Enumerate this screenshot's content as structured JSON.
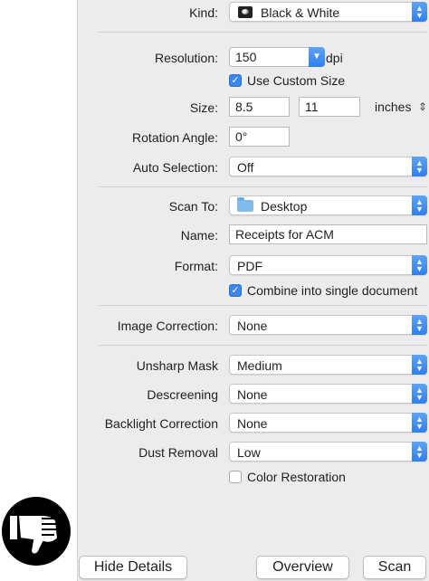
{
  "kind": {
    "label": "Kind:",
    "value": "Black & White"
  },
  "resolution": {
    "label": "Resolution:",
    "value": "150",
    "unit": "dpi"
  },
  "custom_size": {
    "label": "Use Custom Size",
    "checked": true
  },
  "size": {
    "label": "Size:",
    "width": "8.5",
    "height": "11",
    "unit": "inches"
  },
  "rotation": {
    "label": "Rotation Angle:",
    "value": "0°"
  },
  "auto_selection": {
    "label": "Auto Selection:",
    "value": "Off"
  },
  "scan_to": {
    "label": "Scan To:",
    "value": "Desktop"
  },
  "name": {
    "label": "Name:",
    "value": "Receipts for ACM"
  },
  "format": {
    "label": "Format:",
    "value": "PDF"
  },
  "combine": {
    "label": "Combine into single document",
    "checked": true
  },
  "image_correction": {
    "label": "Image Correction:",
    "value": "None"
  },
  "unsharp_mask": {
    "label": "Unsharp Mask",
    "value": "Medium"
  },
  "descreening": {
    "label": "Descreening",
    "value": "None"
  },
  "backlight": {
    "label": "Backlight Correction",
    "value": "None"
  },
  "dust_removal": {
    "label": "Dust Removal",
    "value": "Low"
  },
  "color_restoration": {
    "label": "Color Restoration",
    "checked": false
  },
  "buttons": {
    "hide_details": "Hide Details",
    "overview": "Overview",
    "scan": "Scan"
  },
  "colors": {
    "accent": "#3b86f0",
    "panel": "#ececec"
  }
}
